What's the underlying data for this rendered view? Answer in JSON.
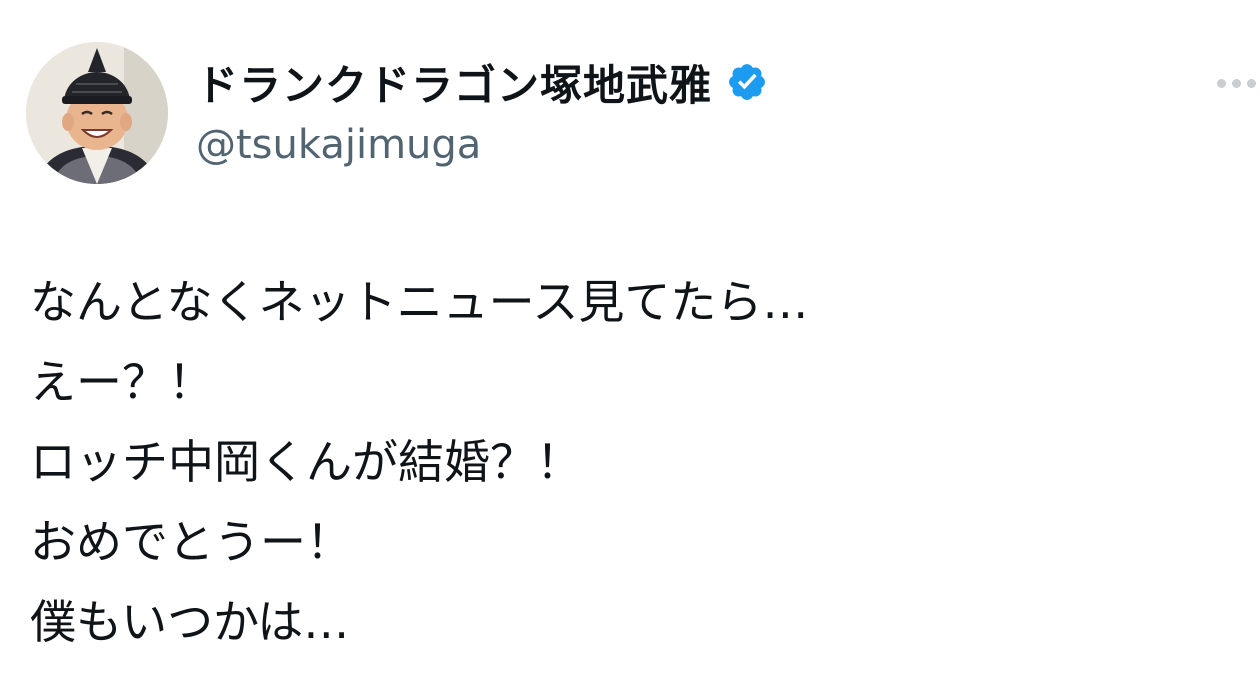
{
  "author": {
    "display_name": "ドランクドラゴン塚地武雅",
    "handle": "@tsukajimuga",
    "verified": true,
    "avatar_icon": "profile-photo"
  },
  "actions": {
    "more_icon": "more-dots-icon"
  },
  "tweet": {
    "lines": [
      "なんとなくネットニュース見てたら…",
      "えー？！",
      "ロッチ中岡くんが結婚？！",
      "おめでとうー！",
      "僕もいつかは…"
    ]
  },
  "colors": {
    "text_primary": "#0f1419",
    "text_secondary": "#536471",
    "verified_blue": "#1d9bf0",
    "more_dots": "#c9ced3"
  }
}
